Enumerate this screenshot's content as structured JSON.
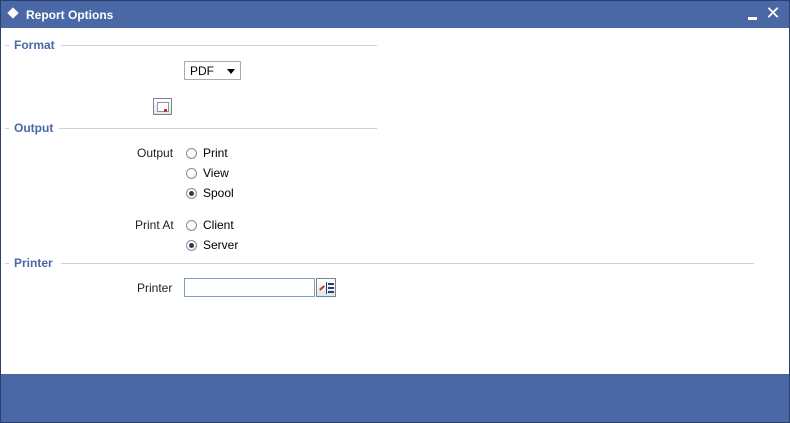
{
  "window": {
    "title": "Report Options",
    "minimize_icon": "minimize-icon",
    "close_icon": "close-icon"
  },
  "format": {
    "section_label": "Format",
    "format_select_value": "PDF"
  },
  "output": {
    "section_label": "Output",
    "output_label": "Output",
    "output_options": [
      {
        "label": "Print",
        "checked": false
      },
      {
        "label": "View",
        "checked": false
      },
      {
        "label": "Spool",
        "checked": true
      }
    ],
    "print_at_label": "Print At",
    "print_at_options": [
      {
        "label": "Client",
        "checked": false
      },
      {
        "label": "Server",
        "checked": true
      }
    ]
  },
  "printer": {
    "section_label": "Printer",
    "printer_label": "Printer",
    "printer_value": ""
  },
  "colors": {
    "title_bar": "#4a68a6",
    "section_label": "#4a68a6"
  }
}
